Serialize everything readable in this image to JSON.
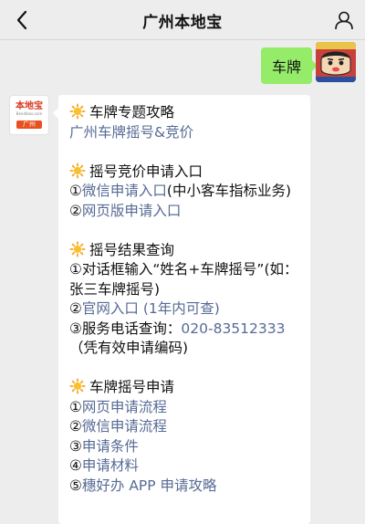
{
  "header": {
    "title": "广州本地宝"
  },
  "sent_message": {
    "text": "车牌"
  },
  "bot_avatar": {
    "logo_text": "本地宝",
    "logo_sub": "Bendibao.com",
    "city": "广州"
  },
  "message": {
    "s1": {
      "heading": "车牌专题攻略",
      "link": "广州车牌摇号&竞价"
    },
    "s2": {
      "heading": "摇号竞价申请入口",
      "item1_num": "①",
      "item1_link": "微信申请入口",
      "item1_rest": "(中小客车指标业务)",
      "item2_num": "②",
      "item2_link": "网页版申请入口"
    },
    "s3": {
      "heading": "摇号结果查询",
      "item1": "①对话框输入“姓名+车牌摇号”(如：张三车牌摇号)",
      "item2_num": "②",
      "item2_link": "官网入口 (1年内可查)",
      "item3_text": "③服务电话查询：",
      "item3_phone": "020-83512333",
      "item3_rest": "（凭有效申请编码)"
    },
    "s4": {
      "heading": "车牌摇号申请",
      "items": [
        {
          "num": "①",
          "link": "网页申请流程"
        },
        {
          "num": "②",
          "link": "微信申请流程"
        },
        {
          "num": "③",
          "link": "申请条件"
        },
        {
          "num": "④",
          "link": "申请材料"
        },
        {
          "num": "⑤",
          "link": "穗好办 APP 申请攻略"
        }
      ]
    }
  },
  "colors": {
    "bubble_sent": "#95ec69",
    "link": "#576b95",
    "background": "#ededed"
  },
  "icons": {
    "back": "chevron-left-icon",
    "profile": "person-icon",
    "sun": "sun-emoji-icon"
  }
}
